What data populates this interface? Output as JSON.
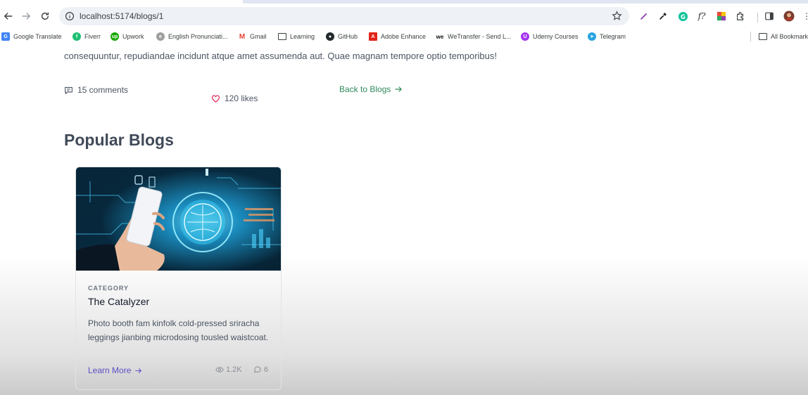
{
  "browser": {
    "url": "localhost:5174/blogs/1",
    "bookmarks": [
      {
        "label": "Google Translate",
        "icon": "google-translate-icon",
        "color": "#4285f4"
      },
      {
        "label": "Fiverr",
        "icon": "fiverr-icon",
        "color": "#1dbf73"
      },
      {
        "label": "Upwork",
        "icon": "upwork-icon",
        "color": "#14a800"
      },
      {
        "label": "English Pronunciati...",
        "icon": "pronunciation-icon",
        "color": "#777777"
      },
      {
        "label": "Gmail",
        "icon": "gmail-icon",
        "color": "#ea4335"
      },
      {
        "label": "Learning",
        "icon": "folder-icon",
        "color": "#3c4043"
      },
      {
        "label": "GitHub",
        "icon": "github-icon",
        "color": "#24292f"
      },
      {
        "label": "Adobe Enhance",
        "icon": "adobe-icon",
        "color": "#e1251b"
      },
      {
        "label": "WeTransfer - Send L...",
        "icon": "wetransfer-icon",
        "color": "#111111"
      },
      {
        "label": "Udemy Courses",
        "icon": "udemy-icon",
        "color": "#a435f0"
      },
      {
        "label": "Telegram",
        "icon": "telegram-icon",
        "color": "#2aa3df"
      }
    ],
    "all_bookmarks": "All Bookmarks"
  },
  "post": {
    "paragraph_tail": "consequuntur, repudiandae incidunt atque amet assumenda aut. Quae magnam tempore optio temporibus!",
    "comments": "15 comments",
    "likes": "120 likes",
    "back_link": "Back to Blogs"
  },
  "popular": {
    "title": "Popular Blogs",
    "card": {
      "category": "CATEGORY",
      "title": "The Catalyzer",
      "description": "Photo booth fam kinfolk cold-pressed sriracha leggings jianbing microdosing tousled waistcoat.",
      "link": "Learn More",
      "views": "1.2K",
      "comments": "6"
    }
  },
  "colors": {
    "link_green": "#2f8a5a",
    "link_purple": "#5b4fc4",
    "heart_red": "#e11d48"
  }
}
